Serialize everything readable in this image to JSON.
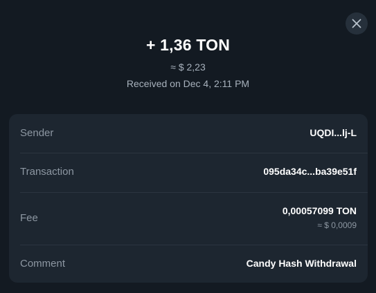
{
  "transaction": {
    "amount": "+ 1,36 TON",
    "fiat": "≈ $ 2,23",
    "received": "Received on Dec 4, 2:11 PM"
  },
  "details": [
    {
      "label": "Sender",
      "value": "UQDI...lj-L"
    },
    {
      "label": "Transaction",
      "value": "095da34c...ba39e51f"
    },
    {
      "label": "Fee",
      "value": "0,00057099 TON",
      "subvalue": "≈ $ 0,0009"
    },
    {
      "label": "Comment",
      "value": "Candy Hash Withdrawal"
    }
  ],
  "icons": {
    "close": "close-icon"
  },
  "colors": {
    "background": "#131a22",
    "card": "#1d2630",
    "primary_text": "#ffffff",
    "secondary_text": "#8d97a2"
  }
}
